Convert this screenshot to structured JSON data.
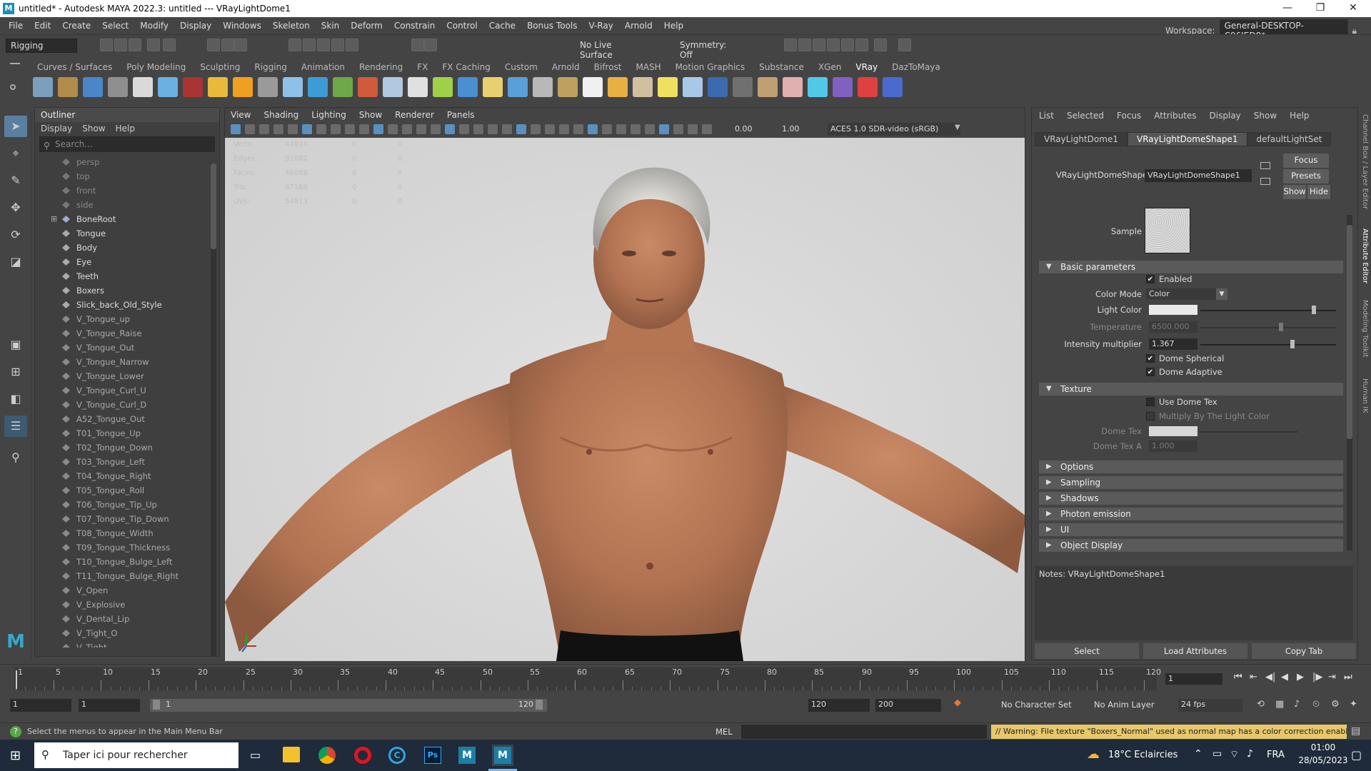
{
  "window": {
    "title": "untitled* - Autodesk MAYA 2022.3: untitled  ---  VRayLightDome1",
    "controls": [
      "—",
      "❐",
      "✕"
    ]
  },
  "menubar": {
    "items": [
      "File",
      "Edit",
      "Create",
      "Select",
      "Modify",
      "Display",
      "Windows",
      "Skeleton",
      "Skin",
      "Deform",
      "Constrain",
      "Control",
      "Cache",
      "Bonus Tools",
      "V-Ray",
      "Arnold",
      "Help"
    ],
    "workspace_label": "Workspace:",
    "workspace_value": "General-DESKTOP-C96IED8*"
  },
  "statusline": {
    "menuset": "Rigging",
    "live_surface": "No Live Surface",
    "symmetry": "Symmetry: Off"
  },
  "shelf": {
    "tabs": [
      "Curves / Surfaces",
      "Poly Modeling",
      "Sculpting",
      "Rigging",
      "Animation",
      "Rendering",
      "FX",
      "FX Caching",
      "Custom",
      "Arnold",
      "Bifrost",
      "MASH",
      "Motion Graphics",
      "Substance",
      "XGen",
      "VRay",
      "DazToMaya"
    ],
    "active_tab": "VRay"
  },
  "outliner": {
    "title": "Outliner",
    "menus": [
      "Display",
      "Show",
      "Help"
    ],
    "search_placeholder": "Search...",
    "items": [
      {
        "label": "persp",
        "kind": "camera"
      },
      {
        "label": "top",
        "kind": "camera"
      },
      {
        "label": "front",
        "kind": "camera"
      },
      {
        "label": "side",
        "kind": "camera"
      },
      {
        "label": "BoneRoot",
        "kind": "joint"
      },
      {
        "label": "Tongue",
        "kind": "mesh"
      },
      {
        "label": "Body",
        "kind": "mesh"
      },
      {
        "label": "Eye",
        "kind": "mesh"
      },
      {
        "label": "Teeth",
        "kind": "mesh"
      },
      {
        "label": "Boxers",
        "kind": "mesh"
      },
      {
        "label": "Slick_back_Old_Style",
        "kind": "mesh"
      },
      {
        "label": "V_Tongue_up",
        "kind": "blend"
      },
      {
        "label": "V_Tongue_Raise",
        "kind": "blend"
      },
      {
        "label": "V_Tongue_Out",
        "kind": "blend"
      },
      {
        "label": "V_Tongue_Narrow",
        "kind": "blend"
      },
      {
        "label": "V_Tongue_Lower",
        "kind": "blend"
      },
      {
        "label": "V_Tongue_Curl_U",
        "kind": "blend"
      },
      {
        "label": "V_Tongue_Curl_D",
        "kind": "blend"
      },
      {
        "label": "A52_Tongue_Out",
        "kind": "blend"
      },
      {
        "label": "T01_Tongue_Up",
        "kind": "blend"
      },
      {
        "label": "T02_Tongue_Down",
        "kind": "blend"
      },
      {
        "label": "T03_Tongue_Left",
        "kind": "blend"
      },
      {
        "label": "T04_Tongue_Right",
        "kind": "blend"
      },
      {
        "label": "T05_Tongue_Roll",
        "kind": "blend"
      },
      {
        "label": "T06_Tongue_Tip_Up",
        "kind": "blend"
      },
      {
        "label": "T07_Tongue_Tip_Down",
        "kind": "blend"
      },
      {
        "label": "T08_Tongue_Width",
        "kind": "blend"
      },
      {
        "label": "T09_Tongue_Thickness",
        "kind": "blend"
      },
      {
        "label": "T10_Tongue_Bulge_Left",
        "kind": "blend"
      },
      {
        "label": "T11_Tongue_Bulge_Right",
        "kind": "blend"
      },
      {
        "label": "V_Open",
        "kind": "blend"
      },
      {
        "label": "V_Explosive",
        "kind": "blend"
      },
      {
        "label": "V_Dental_Lip",
        "kind": "blend"
      },
      {
        "label": "V_Tight_O",
        "kind": "blend"
      },
      {
        "label": "V_Tight",
        "kind": "blend"
      }
    ]
  },
  "viewport": {
    "menus": [
      "View",
      "Shading",
      "Lighting",
      "Show",
      "Renderer",
      "Panels"
    ],
    "exposure": "0.00",
    "gamma": "1.00",
    "colorspace": "ACES 1.0 SDR-video (sRGB)",
    "hud": [
      {
        "label": "Verts:",
        "v1": "44924",
        "v2": "0",
        "v3": "0"
      },
      {
        "label": "Edges:",
        "v1": "91082",
        "v2": "0",
        "v3": "0"
      },
      {
        "label": "Faces:",
        "v1": "46068",
        "v2": "0",
        "v3": "0"
      },
      {
        "label": "Tris:",
        "v1": "87188",
        "v2": "0",
        "v3": "0"
      },
      {
        "label": "UVs:",
        "v1": "54813",
        "v2": "0",
        "v3": "0"
      }
    ]
  },
  "attribute_editor": {
    "menus": [
      "List",
      "Selected",
      "Focus",
      "Attributes",
      "Display",
      "Show",
      "Help"
    ],
    "tabs": [
      "VRayLightDome1",
      "VRayLightDomeShape1",
      "defaultLightSet"
    ],
    "active_tab": "VRayLightDomeShape1",
    "node_label": "VRayLightDomeShape:",
    "node_value": "VRayLightDomeShape1",
    "buttons": {
      "focus": "Focus",
      "presets": "Presets",
      "show": "Show",
      "hide": "Hide"
    },
    "sample_label": "Sample",
    "sections": {
      "basic": "Basic parameters",
      "texture": "Texture",
      "collapsed": [
        "Options",
        "Sampling",
        "Shadows",
        "Photon emission",
        "UI",
        "Object Display"
      ]
    },
    "basic": {
      "enabled": "Enabled",
      "color_mode_label": "Color Mode",
      "color_mode_value": "Color",
      "light_color_label": "Light Color",
      "temperature_label": "Temperature",
      "temperature_value": "6500.000",
      "intensity_label": "Intensity multiplier",
      "intensity_value": "1.367",
      "dome_spherical": "Dome Spherical",
      "dome_adaptive": "Dome Adaptive"
    },
    "texture": {
      "use_dome_tex": "Use Dome Tex",
      "multiply": "Multiply By The Light Color",
      "dome_tex_label": "Dome Tex",
      "dome_tex_a_label": "Dome Tex A",
      "dome_tex_a_value": "1.000"
    },
    "notes": "Notes:  VRayLightDomeShape1",
    "bottom_buttons": [
      "Select",
      "Load Attributes",
      "Copy Tab"
    ],
    "side_tabs": [
      "Channel Box / Layer Editor",
      "Attribute Editor",
      "Modeling Toolkit",
      "Human IK"
    ]
  },
  "timeslider": {
    "ticks": [
      "1",
      "5",
      "10",
      "15",
      "20",
      "25",
      "30",
      "35",
      "40",
      "45",
      "50",
      "55",
      "60",
      "65",
      "70",
      "75",
      "80",
      "85",
      "90",
      "95",
      "100",
      "105",
      "110",
      "115",
      "120"
    ],
    "current_frame": "1"
  },
  "rangeslider": {
    "start": "1",
    "anim_start": "1",
    "range_start": "1",
    "range_end": "120",
    "anim_end_field": "120",
    "end_field": "200",
    "character_set": "No Character Set",
    "anim_layer": "No Anim Layer",
    "fps": "24 fps"
  },
  "commandline": {
    "help": "Select the menus to appear in the Main Menu Bar",
    "lang": "MEL",
    "warning": "// Warning: File texture \"Boxers_Normal\" used as normal map has a color correction enabled. Thi"
  },
  "taskbar": {
    "search_placeholder": "Taper ici pour rechercher",
    "weather": "18°C  Eclaircies",
    "lang": "FRA",
    "time": "01:00",
    "date": "28/05/2023"
  }
}
